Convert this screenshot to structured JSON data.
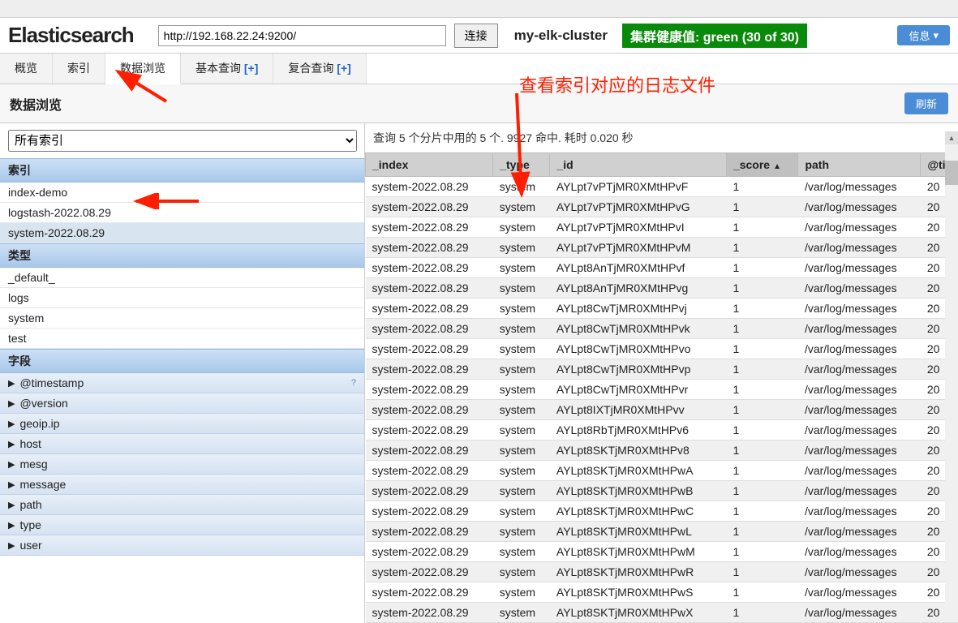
{
  "topbar": [
    "",
    "",
    "",
    "",
    "",
    "",
    "",
    "",
    ""
  ],
  "logo": "Elasticsearch",
  "url": "http://192.168.22.24:9200/",
  "connect": "连接",
  "cluster_name": "my-elk-cluster",
  "health": "集群健康值: green (30 of 30)",
  "info_btn": "信息",
  "tabs": [
    {
      "label": "概览",
      "active": false
    },
    {
      "label": "索引",
      "active": false
    },
    {
      "label": "数据浏览",
      "active": true
    },
    {
      "label": "基本查询",
      "plus": "[+]",
      "active": false
    },
    {
      "label": "复合查询",
      "plus": "[+]",
      "active": false
    }
  ],
  "subhead": "数据浏览",
  "refresh": "刷新",
  "index_select": "所有索引",
  "sidebar": {
    "cat_index": "索引",
    "indices": [
      {
        "name": "index-demo",
        "sel": false
      },
      {
        "name": "logstash-2022.08.29",
        "sel": false
      },
      {
        "name": "system-2022.08.29",
        "sel": true
      }
    ],
    "cat_type": "类型",
    "types": [
      "_default_",
      "logs",
      "system",
      "test"
    ],
    "cat_field": "字段",
    "fields": [
      "@timestamp",
      "@version",
      "geoip.ip",
      "host",
      "mesg",
      "message",
      "path",
      "type",
      "user"
    ]
  },
  "query_info": "查询 5 个分片中用的 5 个. 9927 命中. 耗时 0.020 秒",
  "columns": [
    "_index",
    "_type",
    "_id",
    "_score",
    "path",
    "@ti"
  ],
  "rows": [
    {
      "index": "system-2022.08.29",
      "type": "system",
      "id": "AYLpt7vPTjMR0XMtHPvF",
      "score": "1",
      "path": "/var/log/messages",
      "ts": "20"
    },
    {
      "index": "system-2022.08.29",
      "type": "system",
      "id": "AYLpt7vPTjMR0XMtHPvG",
      "score": "1",
      "path": "/var/log/messages",
      "ts": "20"
    },
    {
      "index": "system-2022.08.29",
      "type": "system",
      "id": "AYLpt7vPTjMR0XMtHPvI",
      "score": "1",
      "path": "/var/log/messages",
      "ts": "20"
    },
    {
      "index": "system-2022.08.29",
      "type": "system",
      "id": "AYLpt7vPTjMR0XMtHPvM",
      "score": "1",
      "path": "/var/log/messages",
      "ts": "20"
    },
    {
      "index": "system-2022.08.29",
      "type": "system",
      "id": "AYLpt8AnTjMR0XMtHPvf",
      "score": "1",
      "path": "/var/log/messages",
      "ts": "20"
    },
    {
      "index": "system-2022.08.29",
      "type": "system",
      "id": "AYLpt8AnTjMR0XMtHPvg",
      "score": "1",
      "path": "/var/log/messages",
      "ts": "20"
    },
    {
      "index": "system-2022.08.29",
      "type": "system",
      "id": "AYLpt8CwTjMR0XMtHPvj",
      "score": "1",
      "path": "/var/log/messages",
      "ts": "20"
    },
    {
      "index": "system-2022.08.29",
      "type": "system",
      "id": "AYLpt8CwTjMR0XMtHPvk",
      "score": "1",
      "path": "/var/log/messages",
      "ts": "20"
    },
    {
      "index": "system-2022.08.29",
      "type": "system",
      "id": "AYLpt8CwTjMR0XMtHPvo",
      "score": "1",
      "path": "/var/log/messages",
      "ts": "20"
    },
    {
      "index": "system-2022.08.29",
      "type": "system",
      "id": "AYLpt8CwTjMR0XMtHPvp",
      "score": "1",
      "path": "/var/log/messages",
      "ts": "20"
    },
    {
      "index": "system-2022.08.29",
      "type": "system",
      "id": "AYLpt8CwTjMR0XMtHPvr",
      "score": "1",
      "path": "/var/log/messages",
      "ts": "20"
    },
    {
      "index": "system-2022.08.29",
      "type": "system",
      "id": "AYLpt8IXTjMR0XMtHPvv",
      "score": "1",
      "path": "/var/log/messages",
      "ts": "20"
    },
    {
      "index": "system-2022.08.29",
      "type": "system",
      "id": "AYLpt8RbTjMR0XMtHPv6",
      "score": "1",
      "path": "/var/log/messages",
      "ts": "20"
    },
    {
      "index": "system-2022.08.29",
      "type": "system",
      "id": "AYLpt8SKTjMR0XMtHPv8",
      "score": "1",
      "path": "/var/log/messages",
      "ts": "20"
    },
    {
      "index": "system-2022.08.29",
      "type": "system",
      "id": "AYLpt8SKTjMR0XMtHPwA",
      "score": "1",
      "path": "/var/log/messages",
      "ts": "20"
    },
    {
      "index": "system-2022.08.29",
      "type": "system",
      "id": "AYLpt8SKTjMR0XMtHPwB",
      "score": "1",
      "path": "/var/log/messages",
      "ts": "20"
    },
    {
      "index": "system-2022.08.29",
      "type": "system",
      "id": "AYLpt8SKTjMR0XMtHPwC",
      "score": "1",
      "path": "/var/log/messages",
      "ts": "20"
    },
    {
      "index": "system-2022.08.29",
      "type": "system",
      "id": "AYLpt8SKTjMR0XMtHPwL",
      "score": "1",
      "path": "/var/log/messages",
      "ts": "20"
    },
    {
      "index": "system-2022.08.29",
      "type": "system",
      "id": "AYLpt8SKTjMR0XMtHPwM",
      "score": "1",
      "path": "/var/log/messages",
      "ts": "20"
    },
    {
      "index": "system-2022.08.29",
      "type": "system",
      "id": "AYLpt8SKTjMR0XMtHPwR",
      "score": "1",
      "path": "/var/log/messages",
      "ts": "20"
    },
    {
      "index": "system-2022.08.29",
      "type": "system",
      "id": "AYLpt8SKTjMR0XMtHPwS",
      "score": "1",
      "path": "/var/log/messages",
      "ts": "20"
    },
    {
      "index": "system-2022.08.29",
      "type": "system",
      "id": "AYLpt8SKTjMR0XMtHPwX",
      "score": "1",
      "path": "/var/log/messages",
      "ts": "20"
    }
  ],
  "annotation": "查看索引对应的日志文件"
}
